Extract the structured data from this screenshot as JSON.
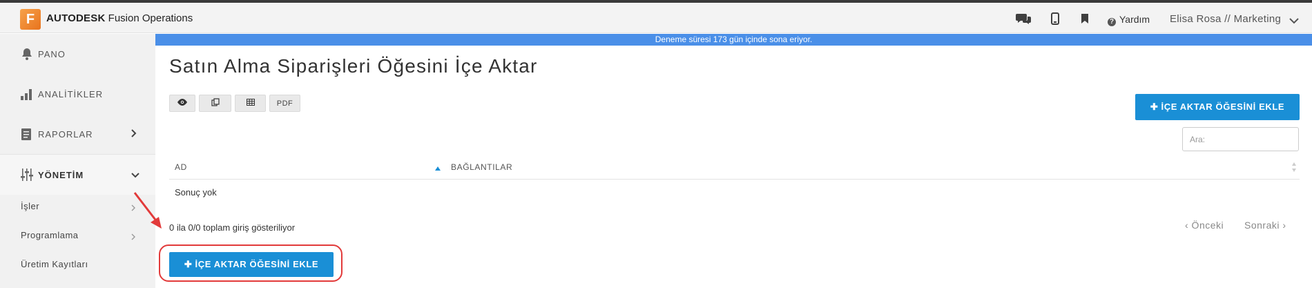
{
  "header": {
    "logo_letter": "F",
    "brand_strong": "AUTODESK",
    "brand_rest": " Fusion Operations",
    "help_label": "Yardım",
    "user_label": "Elisa Rosa // Marketing"
  },
  "banner": {
    "text": "Deneme süresi 173 gün içinde sona eriyor."
  },
  "sidebar": {
    "items": [
      {
        "label": "PANO",
        "icon": "bell-icon"
      },
      {
        "label": "ANALİTİKLER",
        "icon": "bar-chart-icon"
      },
      {
        "label": "RAPORLAR",
        "icon": "report-icon"
      },
      {
        "label": "YÖNETİM",
        "icon": "sliders-icon"
      }
    ],
    "sub_items": [
      {
        "label": "İşler"
      },
      {
        "label": "Programlama"
      },
      {
        "label": "Üretim Kayıtları"
      }
    ]
  },
  "main": {
    "title": "Satın Alma Siparişleri Öğesini İçe Aktar",
    "toolbar": {
      "pdf_label": "PDF"
    },
    "add_button_top": "✚ İÇE AKTAR ÖĞESİNİ EKLE",
    "search_placeholder": "Ara:",
    "table": {
      "columns": [
        "AD",
        "BAĞLANTILAR"
      ],
      "empty_text": "Sonuç yok"
    },
    "info_text": "0 ila 0/0 toplam giriş gösteriliyor",
    "pager": {
      "prev": "‹ Önceki",
      "next": "Sonraki ›"
    },
    "add_button_bottom": "✚ İÇE AKTAR ÖĞESİNİ EKLE"
  },
  "colors": {
    "accent": "#1a8fd6",
    "banner": "#4a8fe8",
    "logo": "#e8731d",
    "annotation": "#e23a3a"
  }
}
